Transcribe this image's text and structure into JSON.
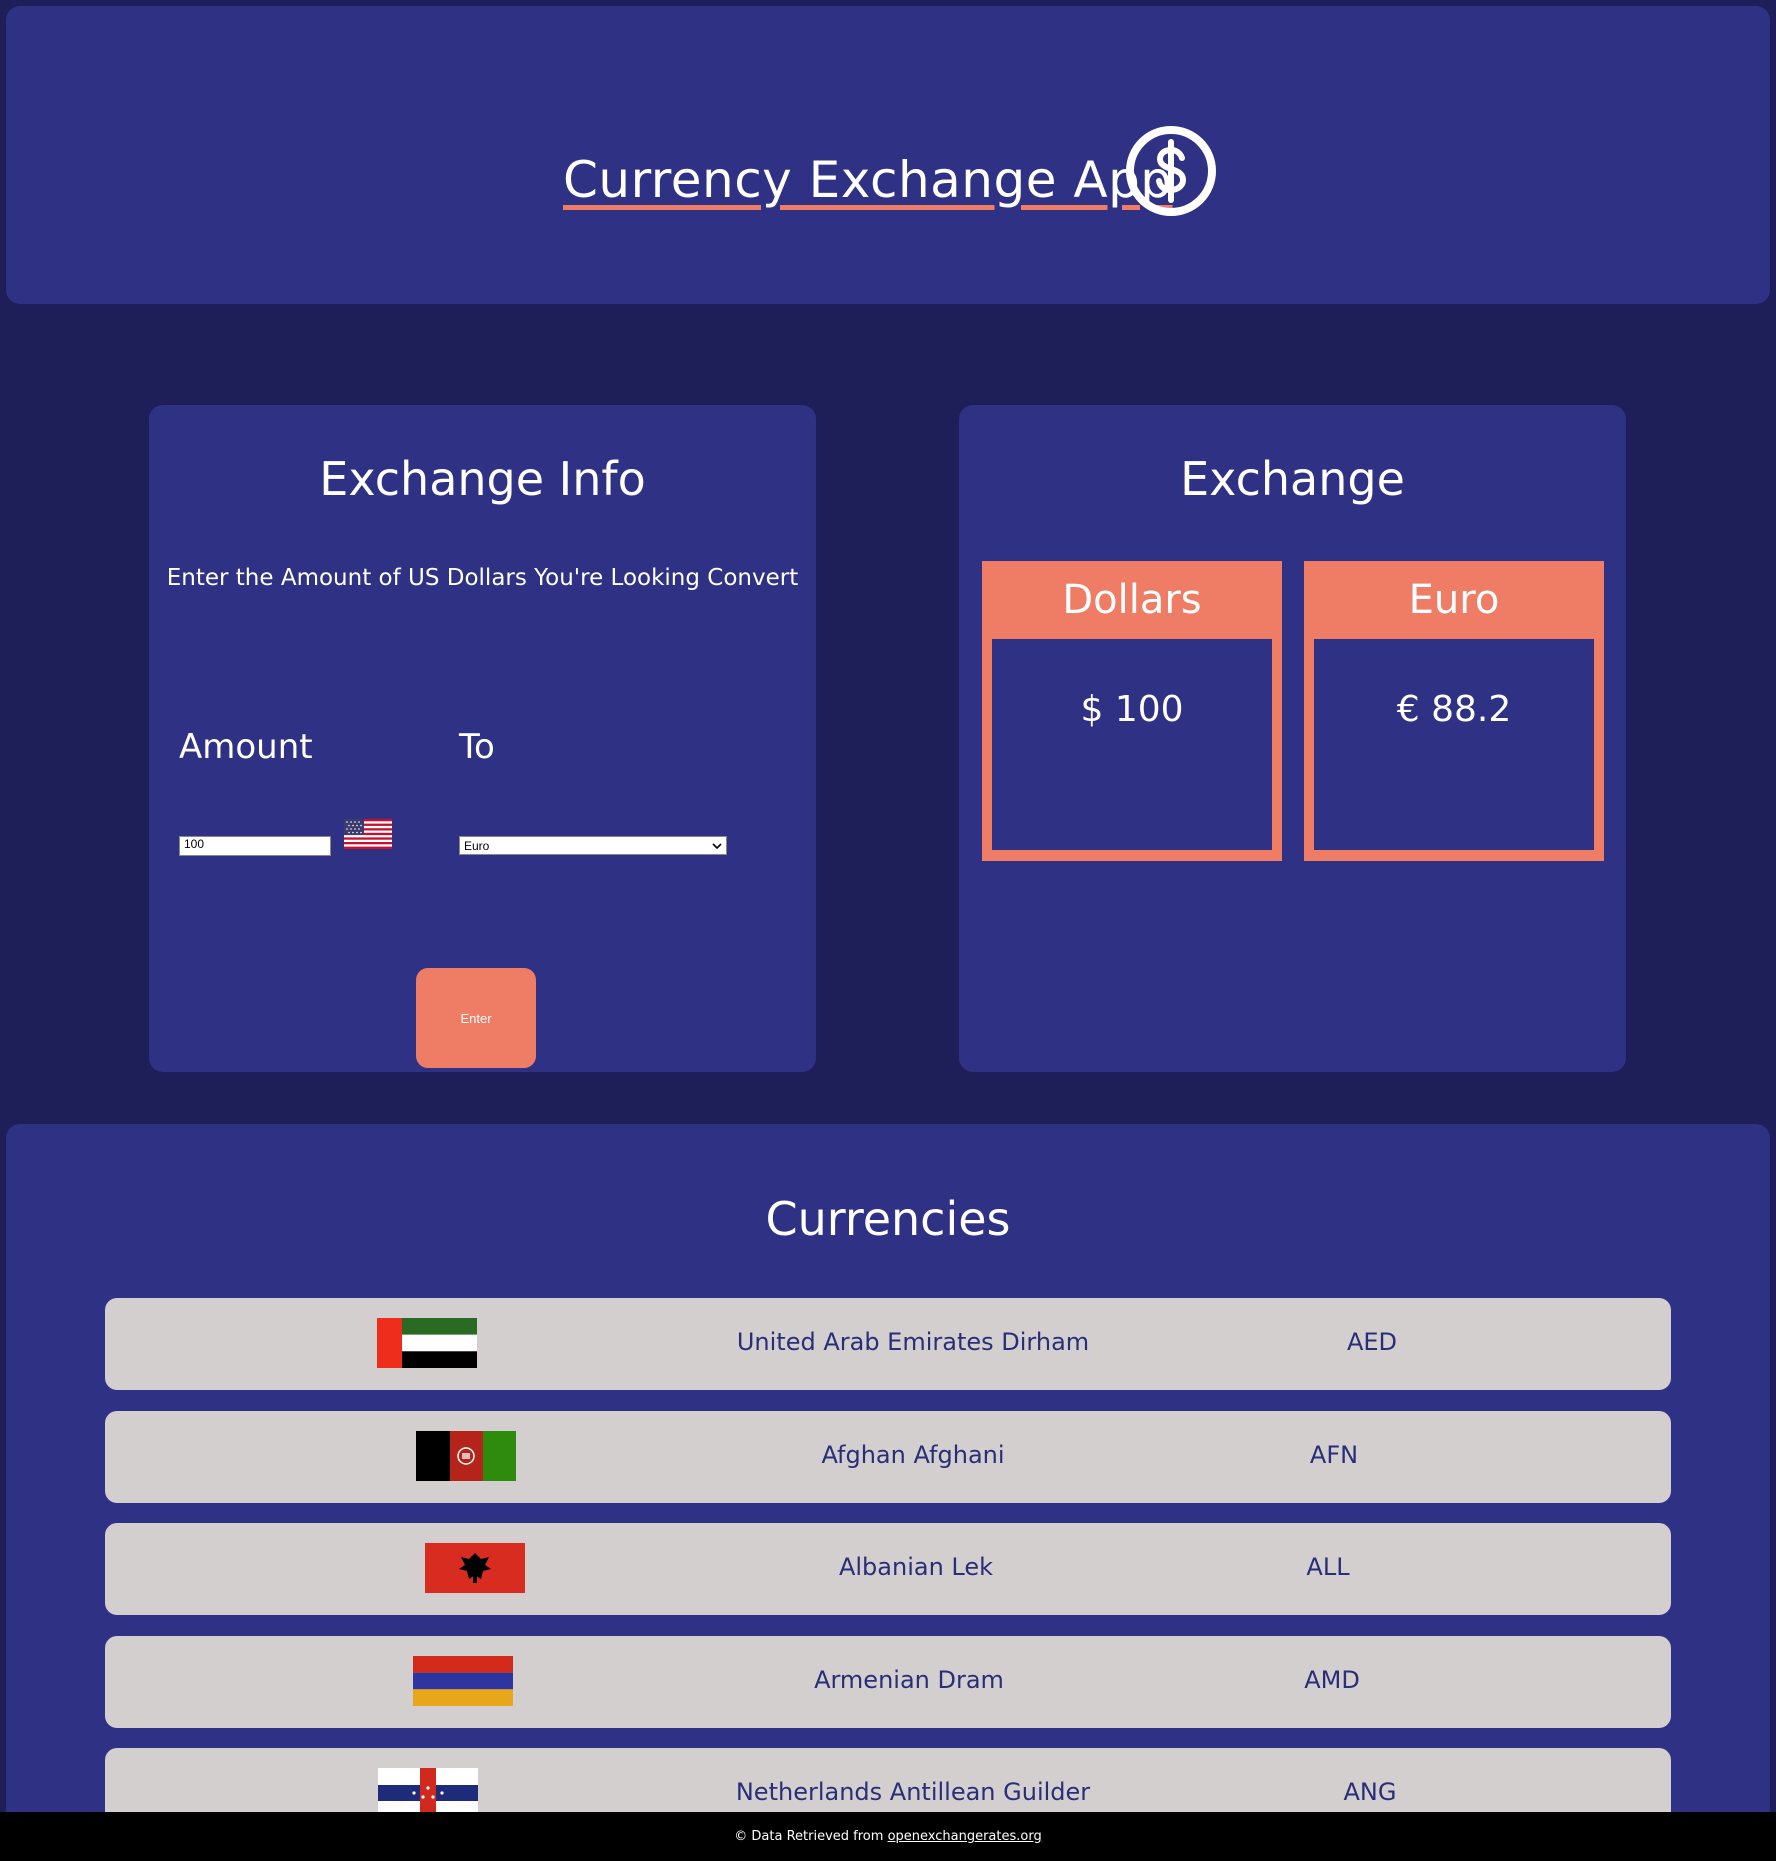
{
  "header": {
    "title": "Currency Exchange App",
    "icon": "dollar-circle-icon"
  },
  "exchange_info": {
    "title": "Exchange Info",
    "instruction": "Enter the Amount of US Dollars You're Looking Convert",
    "amount_label": "Amount",
    "to_label": "To",
    "amount_value": "100",
    "to_selected": "Euro",
    "enter_label": "Enter"
  },
  "exchange": {
    "title": "Exchange",
    "from": {
      "label": "Dollars",
      "value": "$ 100"
    },
    "to": {
      "label": "Euro",
      "value": "€ 88.2"
    }
  },
  "currencies": {
    "title": "Currencies",
    "items": [
      {
        "name": "United Arab Emirates Dirham",
        "code": "AED"
      },
      {
        "name": "Afghan Afghani",
        "code": "AFN"
      },
      {
        "name": "Albanian Lek",
        "code": "ALL"
      },
      {
        "name": "Armenian Dram",
        "code": "AMD"
      },
      {
        "name": "Netherlands Antillean Guilder",
        "code": "ANG"
      }
    ]
  },
  "footer": {
    "text": "© Data Retrieved from",
    "link": "openexchangerates.org"
  },
  "colors": {
    "background": "#1e1f58",
    "panel": "#2e3184",
    "accent": "#ef7d66",
    "row": "#d3cfcf"
  }
}
